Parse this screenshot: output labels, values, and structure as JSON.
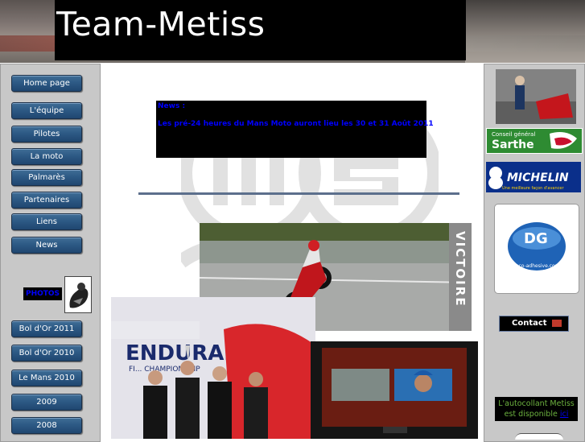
{
  "header": {
    "site_title": "Team-Metiss"
  },
  "left_nav": {
    "main_items": [
      {
        "label": "Home page"
      },
      {
        "label": "L'équipe"
      },
      {
        "label": "Pilotes"
      },
      {
        "label": "La moto"
      },
      {
        "label": "Palmarès"
      },
      {
        "label": "Partenaires"
      },
      {
        "label": "Liens"
      },
      {
        "label": "News"
      }
    ],
    "photos_label": "PHOTOS",
    "event_items": [
      {
        "label": "Bol d'Or 2011"
      },
      {
        "label": "Bol d'Or 2010"
      },
      {
        "label": "Le Mans 2010"
      },
      {
        "label": "2009"
      },
      {
        "label": "2008"
      }
    ]
  },
  "main": {
    "news_title": "News :",
    "news_text": "Les pré-24 heures du Mans Moto auront lieu les 30 et 31 Août 2011",
    "moto_photo_caption": "VICTOIRE",
    "podium_banner": "ENDURAN",
    "podium_subtitle": "FI... CHAMPIONSHIP"
  },
  "right_panel": {
    "sarthe_top": "Conseil général",
    "sarthe_name": "Sarthe",
    "michelin_name": "MICHELIN",
    "michelin_tagline": "Une meilleure façon d'avancer",
    "dg_logo_text": "DG",
    "dg_site": "deco-adhesive.com",
    "contact_label": "Contact",
    "sticker_text": "L'autocollant Metiss est disponible",
    "sticker_link": "ici"
  },
  "colors": {
    "nav_button": "#2d5a85",
    "news_text": "#0000ff",
    "sticker_text": "#6db33f"
  }
}
